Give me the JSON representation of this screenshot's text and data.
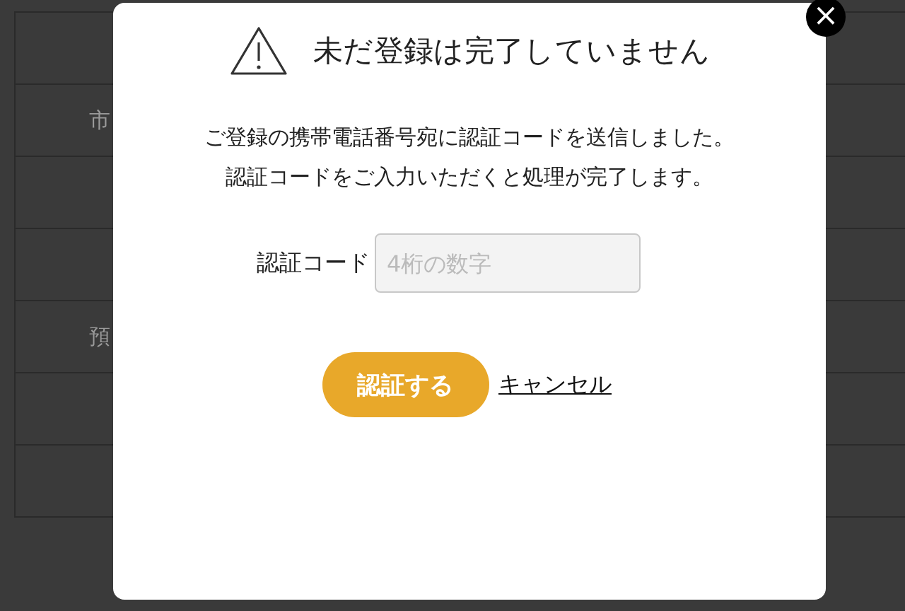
{
  "background_table": {
    "rows": [
      {},
      {
        "label": "市"
      },
      {},
      {},
      {
        "label": "預"
      },
      {},
      {}
    ]
  },
  "dialog": {
    "title": "未だ登録は完了していません",
    "message": [
      "ご登録の携帯電話番号宛に認証コードを送信しました。",
      "認証コードをご入力いただくと処理が完了します。"
    ],
    "field": {
      "label": "認証コード",
      "placeholder": "4桁の数字"
    },
    "submit": "認証する",
    "cancel": "キャンセル",
    "close": "×"
  }
}
